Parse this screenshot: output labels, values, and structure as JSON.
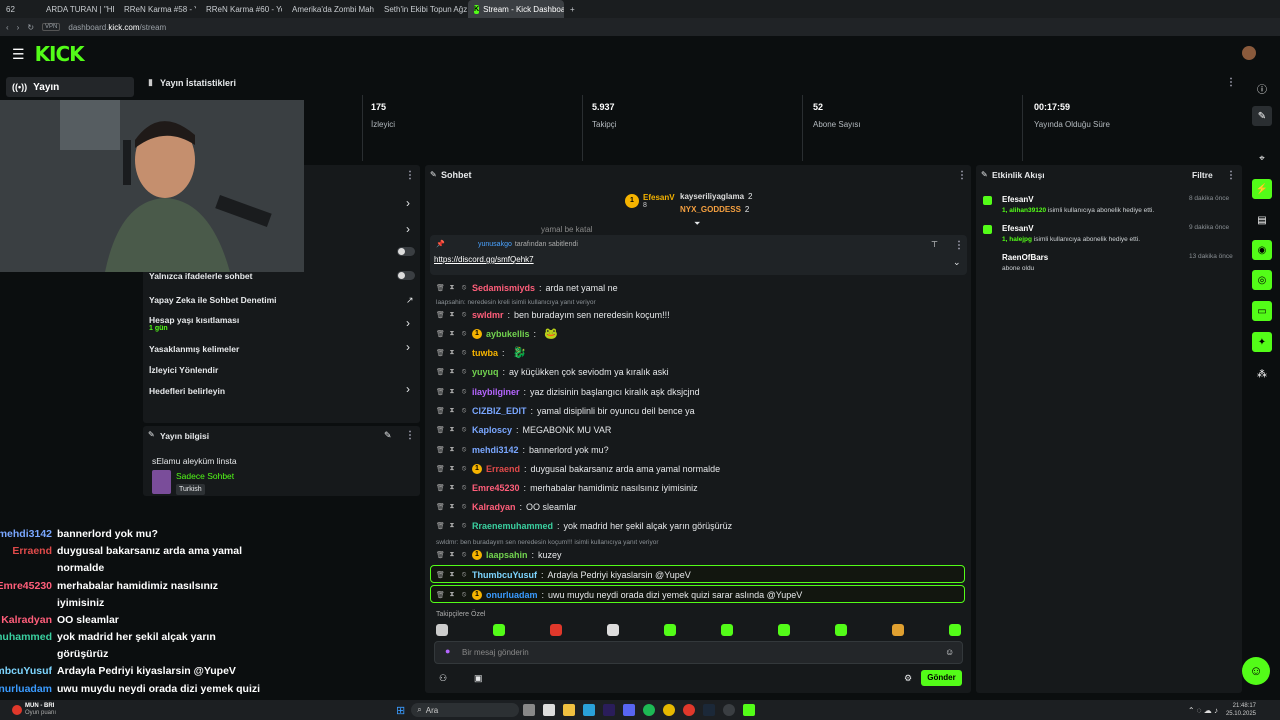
{
  "browser": {
    "tabs": [
      "ARDA TURAN | \"HESAP V",
      "RReN Karma #58 - YouT",
      "RReN Karma #60 - YouT",
      "Amerika'da Zombi Mahsl",
      "Seth'in Ekibi Topun Ağzın",
      "Stream - Kick Dashboard"
    ],
    "tab_count": "62",
    "url_prefix": "dashboard.",
    "url_host": "kick.com",
    "url_path": "/stream",
    "vpn": "VPN"
  },
  "header": {
    "logo": "KICK"
  },
  "nav": {
    "active": "Yayın"
  },
  "stats": {
    "title": "Yayın İstatistikleri",
    "items": [
      {
        "value": "175",
        "label": "İzleyici"
      },
      {
        "value": "5.937",
        "label": "Takipçi"
      },
      {
        "value": "52",
        "label": "Abone Sayısı"
      },
      {
        "value": "00:17:59",
        "label": "Yayında Olduğu Süre"
      }
    ]
  },
  "settings": {
    "rows": [
      "Yalnızca ifadelerle sohbet",
      "Yapay Zeka ile Sohbet Denetimi",
      "Hesap yaşı kısıtlaması",
      "Yasaklanmış kelimeler",
      "İzleyici Yönlendir",
      "Hedefleri belirleyin"
    ],
    "age_value": "1 gün"
  },
  "info": {
    "title": "Yayın bilgisi",
    "stream_title": "sElamu aleyküm linsta",
    "category": "Sadece Sohbet",
    "language": "Turkish"
  },
  "chat": {
    "title": "Sohbet",
    "top_gifters": [
      {
        "name": "EfesanV",
        "count": "8"
      },
      {
        "name": "kayseriliyaglama",
        "count": "2"
      },
      {
        "name": "NYX_GODDESS",
        "count": "2"
      }
    ],
    "pinned_by": "yunusakgo",
    "pinned_suffix": "tarafından sabitlendi",
    "pinned_link": "https://discord.gg/smfQehk7",
    "partial_top": "yamal be katal",
    "reply1": "laapsahin: neredesin kreli isimli kullanıcıya yanıt veriyor",
    "reply2": "swldmr: ben buradayım sen neredesin koçum!!! isimli kullanıcıya yanıt veriyor",
    "messages": [
      {
        "user": "Sedamismiyds",
        "text": "arda net yamal ne",
        "color": "#ff5e7a"
      },
      {
        "user": "swldmr",
        "text": "ben buradayım sen neredesin koçum!!!",
        "color": "#ff5e7a"
      },
      {
        "user": "aybukellis",
        "text": "",
        "color": "#72d34f"
      },
      {
        "user": "tuwba",
        "text": "",
        "color": "#f5b300"
      },
      {
        "user": "yuyuq",
        "text": "ay küçükken çok seviodm ya kıralık aski",
        "color": "#72d34f"
      },
      {
        "user": "ilaybilginer",
        "text": "yaz dizisinin başlangıcı kiralık aşk dksjcjnd",
        "color": "#b565ff"
      },
      {
        "user": "CIZBIZ_EDIT",
        "text": "yamal disiplinli bir oyuncu deil bence ya",
        "color": "#7aa7ff"
      },
      {
        "user": "Kaploscy",
        "text": "MEGABONK MU VAR",
        "color": "#7aa7ff"
      },
      {
        "user": "mehdi3142",
        "text": "bannerlord yok mu?",
        "color": "#7aa7ff"
      },
      {
        "user": "Erraend",
        "text": "duygusal bakarsanız arda ama yamal normalde",
        "color": "#e04a4a"
      },
      {
        "user": "Emre45230",
        "text": "merhabalar hamidimiz nasılsınız iyimisiniz",
        "color": "#ff5e7a"
      },
      {
        "user": "Kalradyan",
        "text": "OO sleamlar",
        "color": "#ff5e7a"
      },
      {
        "user": "Rraenemuhammed",
        "text": "yok madrid her şekil alçak yarın görüşürüz",
        "color": "#3ad0a0"
      },
      {
        "user": "laapsahin",
        "text": "kuzey",
        "color": "#72d34f"
      },
      {
        "user": "ThumbcuYusuf",
        "text": "Ardayla Pedriyi kiyaslarsin @YupeV",
        "color": "#7ed6ff"
      },
      {
        "user": "onurluadam",
        "text": "uwu muydu neydi orada dizi yemek quizi sarar aslında @YupeV",
        "color": "#3a9bff"
      }
    ],
    "follower_label": "Takipçilere Özel",
    "input_placeholder": "Bir mesaj gönderin",
    "send_label": "Gönder"
  },
  "events": {
    "title": "Etkinlik Akışı",
    "filter": "Filtre",
    "items": [
      {
        "name": "EfesanV",
        "count": "1,",
        "target": "alihan39120",
        "desc": "isimli kullanıcıya abonelik hediye etti.",
        "time": "8 dakika önce"
      },
      {
        "name": "EfesanV",
        "count": "1,",
        "target": "halejpg",
        "desc": "isimli kullanıcıya abonelik hediye etti.",
        "time": "9 dakika önce"
      },
      {
        "name": "RaenOfBars",
        "count": "",
        "target": "",
        "desc": "abone oldu",
        "time": "13 dakika önce"
      }
    ]
  },
  "overlay": [
    {
      "user": "mehdi3142",
      "text": "bannerlord yok mu?",
      "color": "#7aa7ff"
    },
    {
      "user": "Erraend",
      "text": "duygusal bakarsanız arda ama yamal",
      "text2": "normalde",
      "color": "#e04a4a"
    },
    {
      "user": "Emre45230",
      "text": "merhabalar hamidimiz nasılsınız",
      "text2": "iyimisiniz",
      "color": "#ff5e7a"
    },
    {
      "user": "Kalradyan",
      "text": "OO sleamlar",
      "color": "#ff5e7a"
    },
    {
      "user": "Rraenemuhammed",
      "text": "yok madrid her şekil alçak yarın",
      "text2": "görüşürüz",
      "color": "#3ad0a0"
    },
    {
      "user": "ThumbcuYusuf",
      "text": "Ardayla Pedriyi kiyaslarsin @YupeV",
      "color": "#7ed6ff"
    },
    {
      "user": "onurluadam",
      "text": "uwu muydu neydi orada dizi yemek quizi",
      "text2": "sarar aslında @YupeV",
      "color": "#3a9bff"
    }
  ],
  "taskbar": {
    "weather_title": "MUN - BRI",
    "weather_sub": "Oyun puanı",
    "search": "Ara",
    "time": "21:48:17",
    "date": "25.10.2025"
  }
}
